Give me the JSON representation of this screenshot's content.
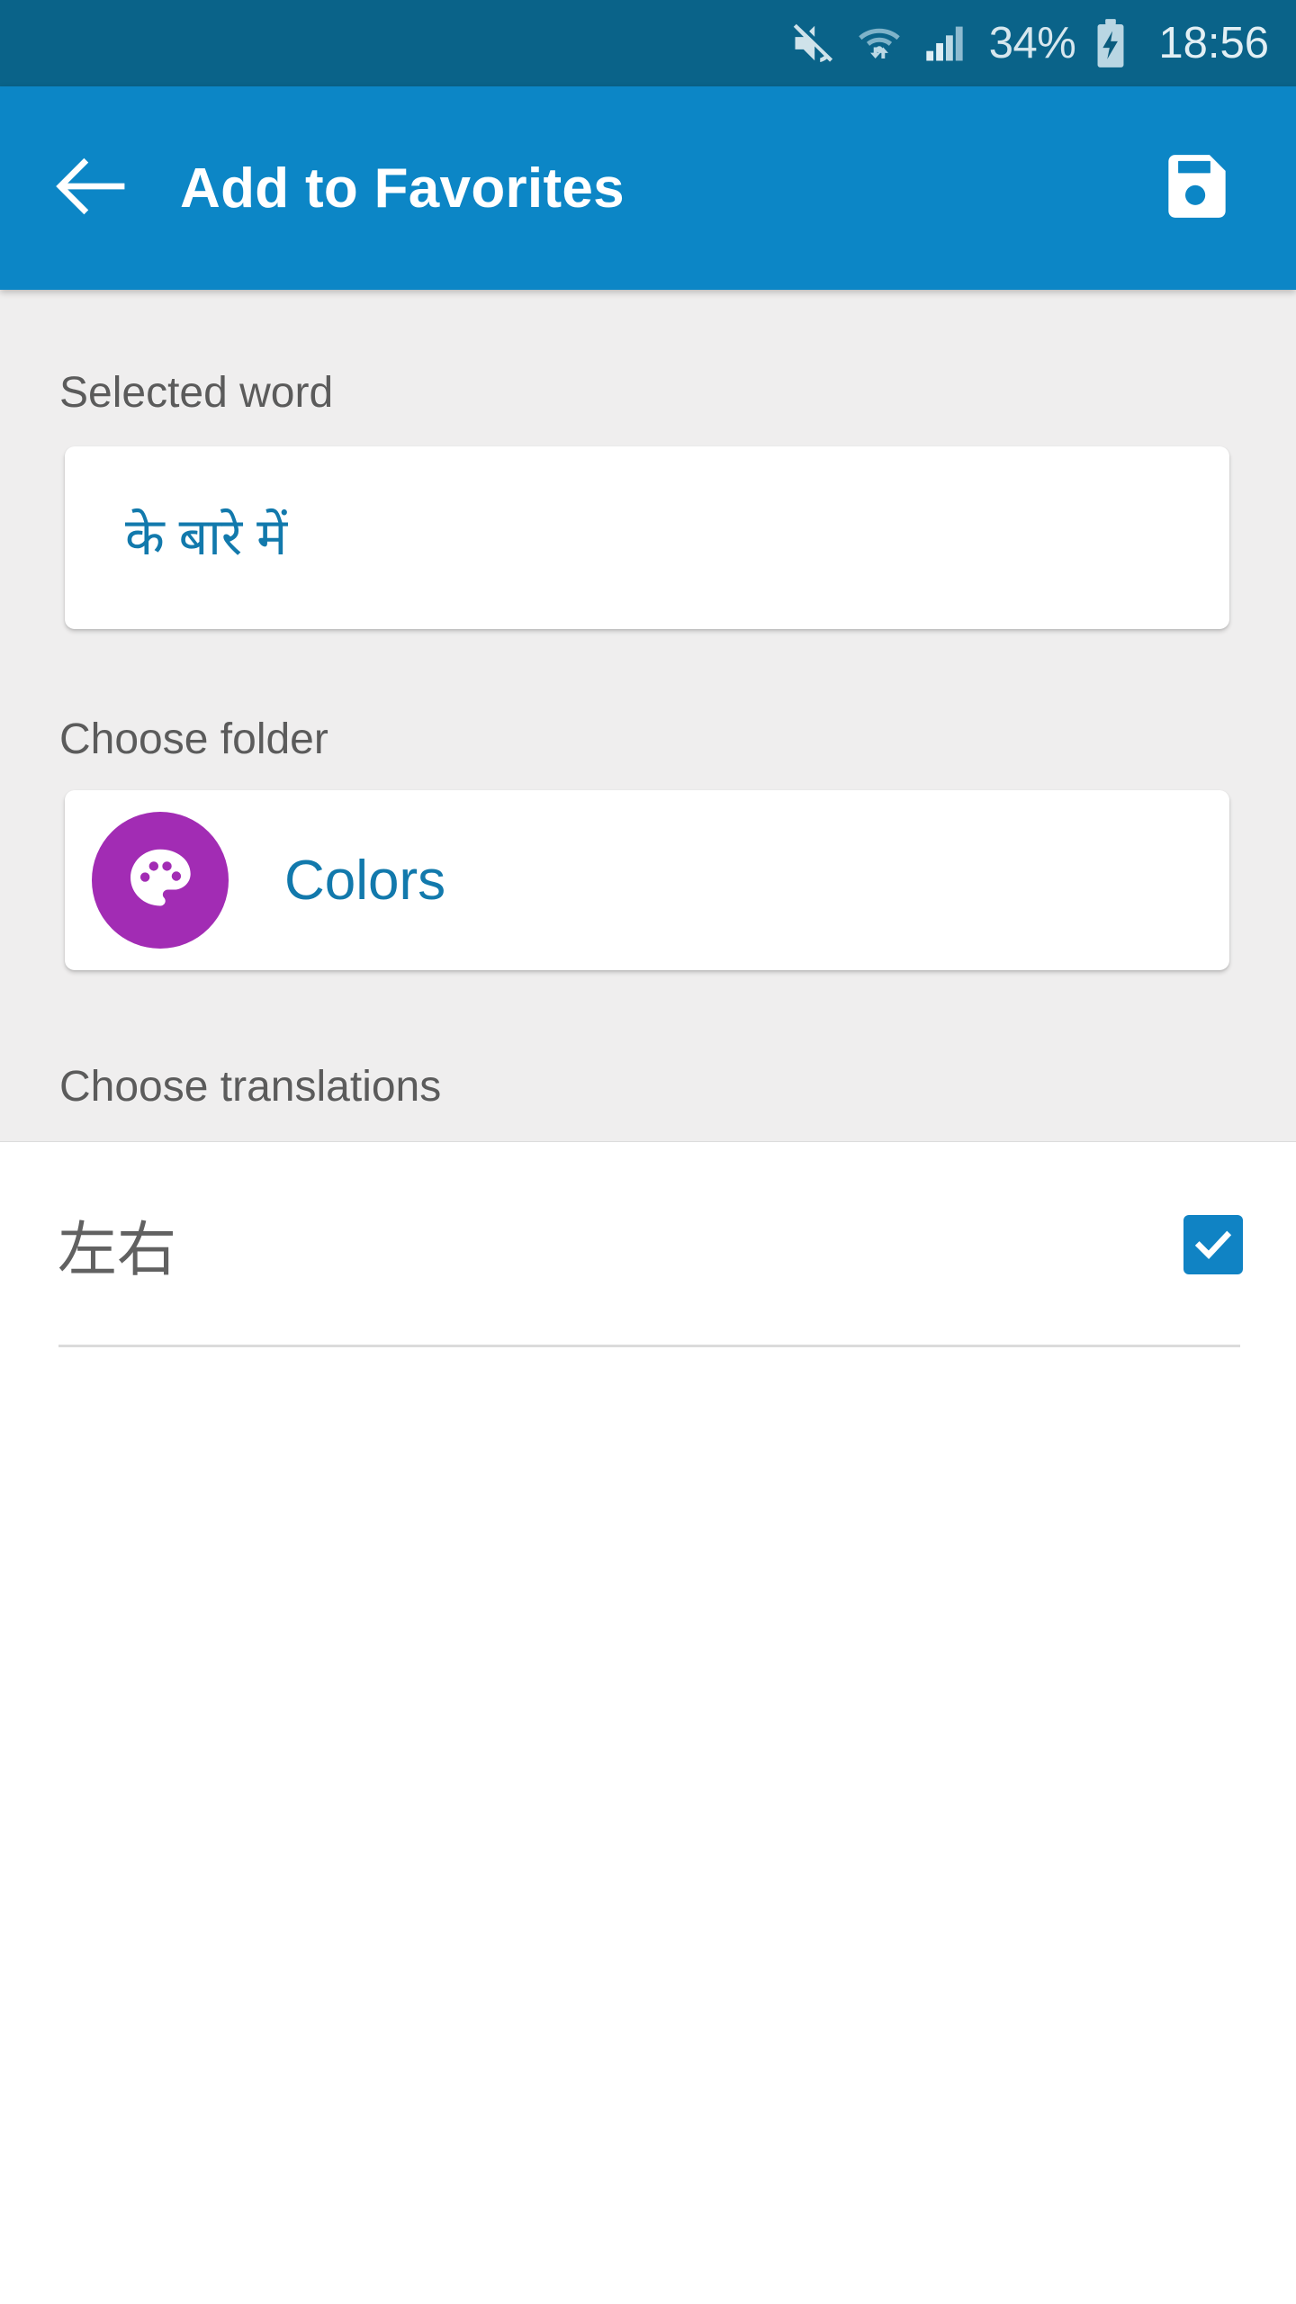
{
  "status_bar": {
    "background_color": "#0a6389",
    "battery_percent": "34%",
    "time": "18:56",
    "icons": [
      "mute-icon",
      "wifi-icon",
      "cellular-signal-icon",
      "battery-charging-icon"
    ]
  },
  "app_bar": {
    "background_color": "#0c86c6",
    "title": "Add to Favorites",
    "back_icon": "back-arrow-icon",
    "save_icon": "save-floppy-icon"
  },
  "content": {
    "background_color": "#efeeee",
    "selected_word": {
      "label": "Selected word",
      "value": "के बारे में",
      "value_color": "#1279ac"
    },
    "choose_folder": {
      "label": "Choose folder",
      "folder_name": "Colors",
      "folder_name_color": "#1279ac",
      "avatar_color": "#a22cb4",
      "avatar_icon": "palette-icon"
    },
    "choose_translations": {
      "label": "Choose translations",
      "items": [
        {
          "text": "左右",
          "checked": true,
          "checkbox_color": "#1083c4"
        }
      ]
    }
  }
}
